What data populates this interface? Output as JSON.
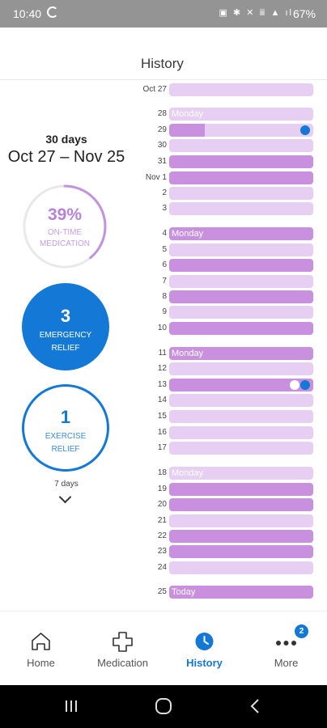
{
  "status_bar": {
    "time": "10:40",
    "battery": "67%",
    "indicators": "▣ ✱ ✕ ⅲ ▲ ıl"
  },
  "header": {
    "title": "History"
  },
  "summary": {
    "period_days": "30 days",
    "period_range": "Oct 27 – Nov 25",
    "on_time": {
      "percent": "39%",
      "percent_value": 39,
      "label_line1": "ON-TIME",
      "label_line2": "MEDICATION"
    },
    "emergency": {
      "count": "3",
      "label_line1": "EMERGENCY",
      "label_line2": "RELIEF"
    },
    "exercise": {
      "count": "1",
      "label_line1": "EXERCISE",
      "label_line2": "RELIEF"
    },
    "toggle_label": "7 days"
  },
  "timeline": [
    {
      "label": "Oct 27",
      "shade": "light"
    },
    {
      "label": "28",
      "shade": "light",
      "weekday": "Monday"
    },
    {
      "label": "29",
      "shade": "light",
      "partial": true,
      "dots": [
        "blue"
      ]
    },
    {
      "label": "30",
      "shade": "light"
    },
    {
      "label": "31",
      "shade": "dark"
    },
    {
      "label": "Nov 1",
      "shade": "dark"
    },
    {
      "label": "2",
      "shade": "light"
    },
    {
      "label": "3",
      "shade": "light"
    },
    {
      "label": "4",
      "shade": "dark",
      "weekday": "Monday"
    },
    {
      "label": "5",
      "shade": "light"
    },
    {
      "label": "6",
      "shade": "dark"
    },
    {
      "label": "7",
      "shade": "light"
    },
    {
      "label": "8",
      "shade": "dark"
    },
    {
      "label": "9",
      "shade": "light"
    },
    {
      "label": "10",
      "shade": "dark"
    },
    {
      "label": "11",
      "shade": "dark",
      "weekday": "Monday"
    },
    {
      "label": "12",
      "shade": "light"
    },
    {
      "label": "13",
      "shade": "dark",
      "dots": [
        "white",
        "blue"
      ]
    },
    {
      "label": "14",
      "shade": "light"
    },
    {
      "label": "15",
      "shade": "light"
    },
    {
      "label": "16",
      "shade": "light"
    },
    {
      "label": "17",
      "shade": "light"
    },
    {
      "label": "18",
      "shade": "light",
      "weekday": "Monday"
    },
    {
      "label": "19",
      "shade": "dark"
    },
    {
      "label": "20",
      "shade": "dark"
    },
    {
      "label": "21",
      "shade": "light"
    },
    {
      "label": "22",
      "shade": "dark"
    },
    {
      "label": "23",
      "shade": "dark"
    },
    {
      "label": "24",
      "shade": "light"
    },
    {
      "label": "25",
      "shade": "dark",
      "weekday": "Today"
    }
  ],
  "nav": {
    "items": [
      {
        "label": "Home",
        "icon": "home-icon"
      },
      {
        "label": "Medication",
        "icon": "medical-cross-icon"
      },
      {
        "label": "History",
        "icon": "clock-icon",
        "active": true
      },
      {
        "label": "More",
        "icon": "more-dots-icon",
        "badge": "2"
      }
    ]
  },
  "colors": {
    "accent_blue": "#1478d6",
    "bar_dark": "#c890df",
    "bar_light": "#e6cff2",
    "ring_purple": "#b683d6"
  }
}
